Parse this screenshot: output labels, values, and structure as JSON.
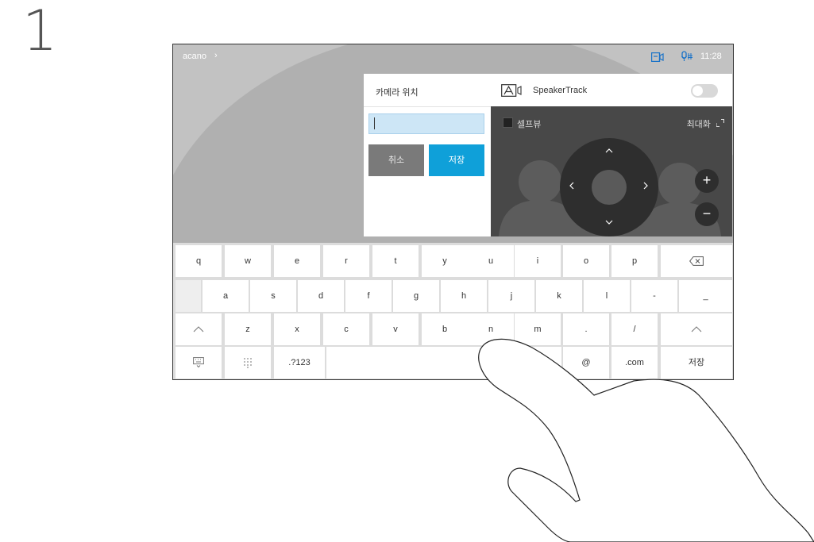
{
  "step": "1",
  "statusbar": {
    "brand": "acano",
    "chevron": "›",
    "clock": "11:28"
  },
  "camera_panel": {
    "title": "카메라 위치",
    "input_value": "",
    "cancel_label": "취소",
    "save_label": "저장"
  },
  "speakertrack_panel": {
    "label": "SpeakerTrack",
    "toggle_on": false,
    "selfview_label": "셀프뷰",
    "maximize_label": "최대화",
    "dpad": {
      "up": "^",
      "down": "v",
      "left": "<",
      "right": ">"
    },
    "zoom_in": "+",
    "zoom_out": "−"
  },
  "keyboard": {
    "row1": [
      "q",
      "w",
      "e",
      "r",
      "t",
      "y",
      "u",
      "i",
      "o",
      "p"
    ],
    "row2": [
      "a",
      "s",
      "d",
      "f",
      "g",
      "h",
      "j",
      "k",
      "l",
      "-",
      "_"
    ],
    "row3": [
      "z",
      "x",
      "c",
      "v",
      "b",
      "n",
      "m",
      ".",
      "/"
    ],
    "row4": {
      "numbers": ".?123",
      "at": "@",
      "com": ".com",
      "save": "저장"
    }
  },
  "colors": {
    "accent": "#0fa0d9",
    "cancel": "#7a7a7a",
    "panel_dark": "#484848",
    "keyboard_bg": "#dcdcdc",
    "input_bg": "#cde6f6"
  },
  "icons": {
    "camera": "camera-icon",
    "mic": "microphone-icon",
    "speakertrack": "speakertrack-icon",
    "backspace": "backspace-icon",
    "shift": "shift-icon",
    "hide_keyboard": "keyboard-hide-icon",
    "dial": "dial-grid-icon",
    "maximize": "maximize-icon"
  }
}
